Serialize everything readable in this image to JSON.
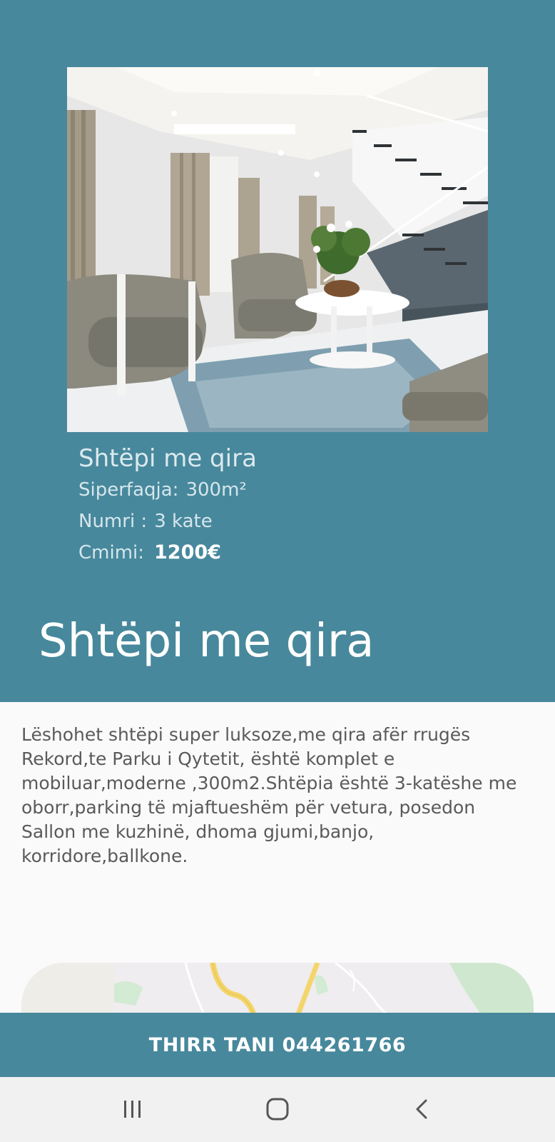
{
  "listing": {
    "title": "Shtëpi me qira",
    "area_label": "Siperfaqja:",
    "area_value": "300m²",
    "floors_label": "Numri :",
    "floors_value": "3 kate",
    "price_label": "Cmimi:",
    "price_value": "1200€"
  },
  "heading": "Shtëpi me qira",
  "description": "Lëshohet shtëpi super luksoze,me qira afër rrugës Rekord,te Parku i Qytetit, është komplet e mobiluar,moderne ,300m2.Shtëpia është 3-katëshe me oborr,parking të mjaftueshëm për vetura, posedon Sallon me kuzhinë, dhoma gjumi,banjo, korridore,ballkone.",
  "cta": {
    "label": "THIRR TANI 044261766"
  },
  "colors": {
    "accent": "#47889c",
    "background": "#fafafa",
    "navbar": "#f1f1f1"
  },
  "icons": {
    "recents": "recents-icon",
    "home": "home-icon",
    "back": "back-icon"
  }
}
